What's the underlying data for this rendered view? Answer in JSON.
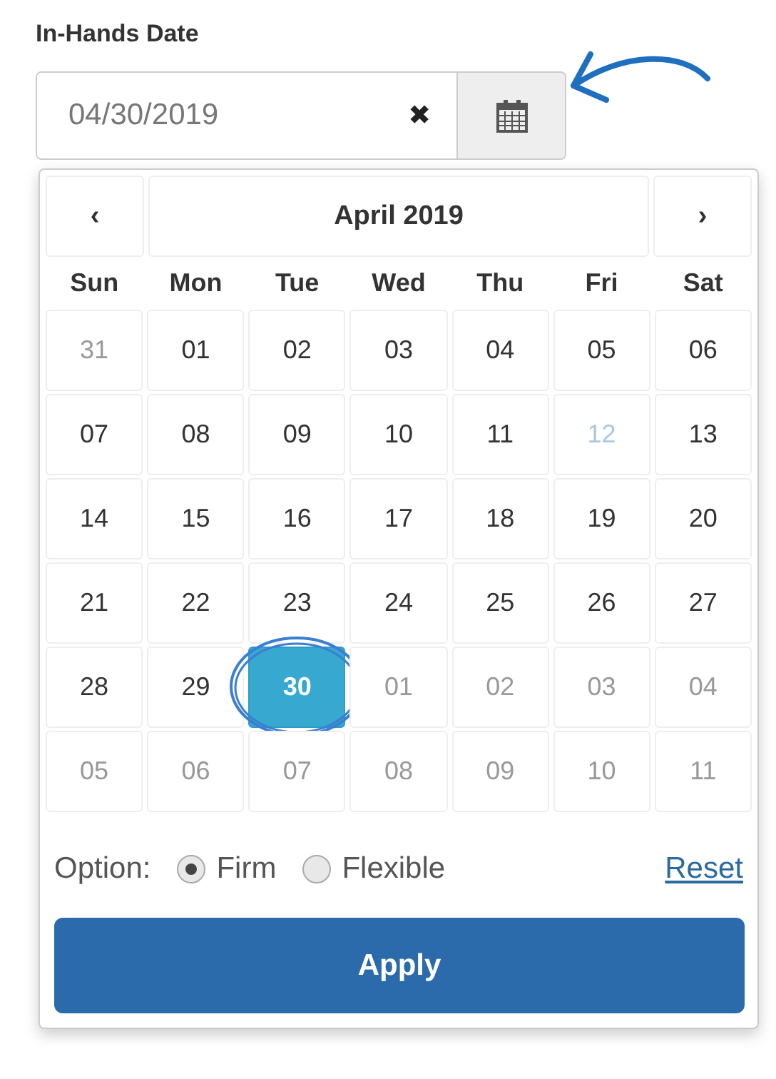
{
  "label": "In-Hands Date",
  "date_field": {
    "value": "04/30/2019",
    "clear": "✖"
  },
  "calendar": {
    "prev": "‹",
    "title": "April 2019",
    "next": "›",
    "weekdays": [
      "Sun",
      "Mon",
      "Tue",
      "Wed",
      "Thu",
      "Fri",
      "Sat"
    ],
    "days": [
      {
        "text": "31",
        "kind": "other",
        "selected": false
      },
      {
        "text": "01",
        "kind": "current",
        "selected": false
      },
      {
        "text": "02",
        "kind": "current",
        "selected": false
      },
      {
        "text": "03",
        "kind": "current",
        "selected": false
      },
      {
        "text": "04",
        "kind": "current",
        "selected": false
      },
      {
        "text": "05",
        "kind": "current",
        "selected": false
      },
      {
        "text": "06",
        "kind": "current",
        "selected": false
      },
      {
        "text": "07",
        "kind": "current",
        "selected": false
      },
      {
        "text": "08",
        "kind": "current",
        "selected": false
      },
      {
        "text": "09",
        "kind": "current",
        "selected": false
      },
      {
        "text": "10",
        "kind": "current",
        "selected": false
      },
      {
        "text": "11",
        "kind": "current",
        "selected": false
      },
      {
        "text": "12",
        "kind": "today",
        "selected": false
      },
      {
        "text": "13",
        "kind": "current",
        "selected": false
      },
      {
        "text": "14",
        "kind": "current",
        "selected": false
      },
      {
        "text": "15",
        "kind": "current",
        "selected": false
      },
      {
        "text": "16",
        "kind": "current",
        "selected": false
      },
      {
        "text": "17",
        "kind": "current",
        "selected": false
      },
      {
        "text": "18",
        "kind": "current",
        "selected": false
      },
      {
        "text": "19",
        "kind": "current",
        "selected": false
      },
      {
        "text": "20",
        "kind": "current",
        "selected": false
      },
      {
        "text": "21",
        "kind": "current",
        "selected": false
      },
      {
        "text": "22",
        "kind": "current",
        "selected": false
      },
      {
        "text": "23",
        "kind": "current",
        "selected": false
      },
      {
        "text": "24",
        "kind": "current",
        "selected": false
      },
      {
        "text": "25",
        "kind": "current",
        "selected": false
      },
      {
        "text": "26",
        "kind": "current",
        "selected": false
      },
      {
        "text": "27",
        "kind": "current",
        "selected": false
      },
      {
        "text": "28",
        "kind": "current",
        "selected": false
      },
      {
        "text": "29",
        "kind": "current",
        "selected": false
      },
      {
        "text": "30",
        "kind": "current",
        "selected": true
      },
      {
        "text": "01",
        "kind": "other",
        "selected": false
      },
      {
        "text": "02",
        "kind": "other",
        "selected": false
      },
      {
        "text": "03",
        "kind": "other",
        "selected": false
      },
      {
        "text": "04",
        "kind": "other",
        "selected": false
      },
      {
        "text": "05",
        "kind": "other",
        "selected": false
      },
      {
        "text": "06",
        "kind": "other",
        "selected": false
      },
      {
        "text": "07",
        "kind": "other",
        "selected": false
      },
      {
        "text": "08",
        "kind": "other",
        "selected": false
      },
      {
        "text": "09",
        "kind": "other",
        "selected": false
      },
      {
        "text": "10",
        "kind": "other",
        "selected": false
      },
      {
        "text": "11",
        "kind": "other",
        "selected": false
      }
    ]
  },
  "option": {
    "label": "Option:",
    "choices": [
      {
        "label": "Firm",
        "selected": true
      },
      {
        "label": "Flexible",
        "selected": false
      }
    ],
    "reset": "Reset"
  },
  "apply": "Apply"
}
